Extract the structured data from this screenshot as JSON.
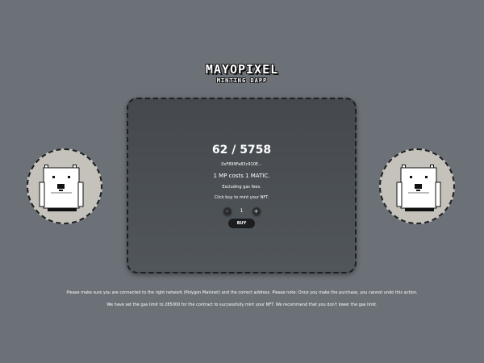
{
  "header": {
    "title": "MAYOPIXEL",
    "subtitle": "MINTING DAPP"
  },
  "mint": {
    "count": "62 / 5758",
    "contract_address": "0xF899Fa83c910E...",
    "cost_text": "1 MP costs 1 MATIC.",
    "gas_text": "Excluding gas fees.",
    "instruction": "Click buy to mint your NFT.",
    "decrement_label": "-",
    "increment_label": "+",
    "quantity": "1",
    "buy_label": "BUY"
  },
  "footer": {
    "network_notice": "Please make sure you are connected to the right network (Polygon Mainnet) and the correct address. Please note: Once you make the purchase, you cannot undo this action.",
    "gas_notice": "We have set the gas limit to 285000 for the contract to successfully mint your NFT. We recommend that you don't lower the gas limit."
  },
  "colors": {
    "background": "#6b7177",
    "card": "#4b4f54",
    "avatar_background": "#c4c2bb",
    "button": "#1c1d1f"
  },
  "icons": {
    "avatar": "pixel-bear-icon"
  }
}
